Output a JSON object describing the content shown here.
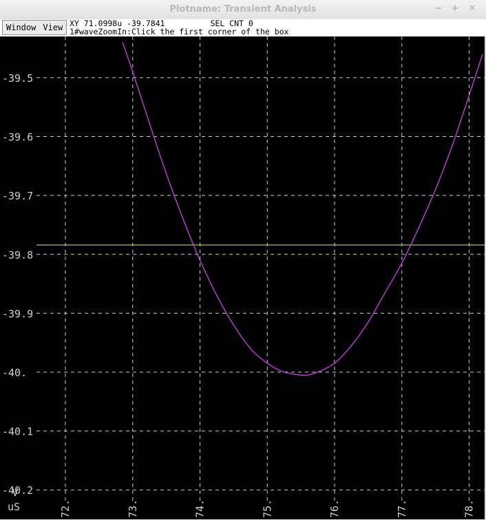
{
  "window": {
    "title": "Plotname: Transient Analysis",
    "controls": [
      "−",
      "+",
      "✕"
    ]
  },
  "menu": {
    "window_label": "Window",
    "view_label": "View"
  },
  "status": {
    "coords": "XY 71.0998u -39.7841",
    "sel_cnt": "SEL CNT 0",
    "message": "1#waveZoomIn:Click the first corner of the box"
  },
  "colors": {
    "background": "#000000",
    "grid": "#cfcfcf",
    "trace": "#e040ff",
    "cursor": "#e8e870",
    "text": "#d0d0d0"
  },
  "chart_data": {
    "type": "line",
    "xlabel": "uS",
    "ylabel": "V",
    "xlim": [
      71.57,
      78.23
    ],
    "ylim": [
      -40.25,
      -39.43
    ],
    "xticks": [
      72,
      73,
      74,
      75,
      76,
      77,
      78
    ],
    "xtick_labels": [
      "72.",
      "73.",
      "74.",
      "75.",
      "76.",
      "77.",
      "78."
    ],
    "yticks": [
      -39.5,
      -39.6,
      -39.7,
      -39.8,
      -39.9,
      -40.0,
      -40.1,
      -40.2
    ],
    "ytick_labels": [
      "-39.5",
      "-39.6",
      "-39.7",
      "-39.8",
      "-39.9",
      "-40.",
      "-40.1",
      "-40.2"
    ],
    "grid": true,
    "cursor_y": -39.7841,
    "series": [
      {
        "x": [
          72.85,
          73.0,
          73.2,
          73.4,
          73.6,
          73.8,
          74.0,
          74.25,
          74.5,
          74.75,
          75.0,
          75.25,
          75.5,
          75.6,
          75.75,
          76.0,
          76.25,
          76.5,
          76.75,
          77.0,
          77.25,
          77.5,
          77.75,
          78.0,
          78.2
        ],
        "y": [
          -39.44,
          -39.49,
          -39.56,
          -39.63,
          -39.695,
          -39.755,
          -39.81,
          -39.87,
          -39.92,
          -39.96,
          -39.985,
          -40.0,
          -40.005,
          -40.005,
          -40.0,
          -39.985,
          -39.955,
          -39.915,
          -39.865,
          -39.815,
          -39.755,
          -39.69,
          -39.615,
          -39.53,
          -39.46
        ]
      }
    ]
  }
}
